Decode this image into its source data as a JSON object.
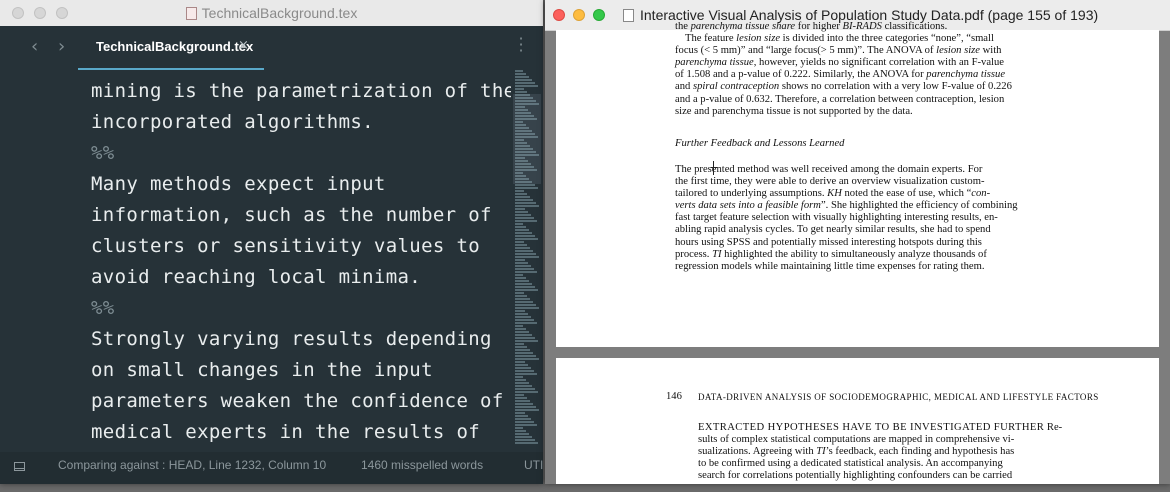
{
  "editor": {
    "window_title": "TechnicalBackground.tex",
    "tab_label": "TechnicalBackground.tex",
    "tab_close": "×",
    "nav_back": "‹",
    "nav_forward": "›",
    "code_lines": [
      {
        "text": "mining is the parametrization of the",
        "comment": false
      },
      {
        "text": "incorporated algorithms.",
        "comment": false
      },
      {
        "text": "%%",
        "comment": true
      },
      {
        "text": "Many methods expect input",
        "comment": false
      },
      {
        "text": "information, such as the number of",
        "comment": false
      },
      {
        "text": "clusters or sensitivity values to",
        "comment": false
      },
      {
        "text": "avoid reaching local minima.",
        "comment": false
      },
      {
        "text": "%%",
        "comment": true
      },
      {
        "text": "Strongly varying results depending",
        "comment": false
      },
      {
        "text": "on small changes in the input",
        "comment": false
      },
      {
        "text": "parameters weaken the confidence of",
        "comment": false
      },
      {
        "text": "medical experts in the results of",
        "comment": false
      }
    ],
    "status": {
      "comparing": "Comparing against : HEAD, Line 1232, Column 10",
      "misspelled": "1460 misspelled words",
      "encoding": "UTI"
    }
  },
  "pdf": {
    "window_title": "Interactive Visual Analysis of Population Study Data.pdf (page 155 of 193)",
    "page1": {
      "para1": [
        [
          {
            "t": "the "
          },
          {
            "t": "parenchyma tissue share",
            "i": true
          },
          {
            "t": " for higher "
          },
          {
            "t": "BI-RADS",
            "i": true
          },
          {
            "t": " classifications."
          }
        ],
        [
          {
            "t": "The feature "
          },
          {
            "t": "lesion size",
            "i": true
          },
          {
            "t": " is divided into the three categories “none”, “small"
          }
        ],
        [
          {
            "t": "focus (< 5 mm)” and “large focus(> 5 mm)”. The ANOVA of "
          },
          {
            "t": "lesion size",
            "i": true
          },
          {
            "t": " with"
          }
        ],
        [
          {
            "t": "parenchyma tissue",
            "i": true
          },
          {
            "t": ", however, yields no significant correlation with an F-value"
          }
        ],
        [
          {
            "t": "of 1.508 and a p-value of 0.222. Similarly, the ANOVA for "
          },
          {
            "t": "parenchyma tissue",
            "i": true
          }
        ],
        [
          {
            "t": "and "
          },
          {
            "t": "spiral contraception",
            "i": true
          },
          {
            "t": " shows no correlation with a very low F-value of 0.226"
          }
        ],
        [
          {
            "t": "and a p-value of 0.632. Therefore, a correlation between contraception, lesion"
          }
        ],
        [
          {
            "t": "size and parenchyma tissue is not supported by the data."
          }
        ]
      ],
      "heading": "Further Feedback and Lessons Learned",
      "para2": [
        [
          {
            "t": "The presented method was well received among the domain experts. For"
          }
        ],
        [
          {
            "t": "the first time, they were able to derive an overview visualization custom-"
          }
        ],
        [
          {
            "t": "tailored to underlying assumptions. "
          },
          {
            "t": "KH",
            "i": true
          },
          {
            "t": " noted the ease of use, which “"
          },
          {
            "t": "con-",
            "i": true
          }
        ],
        [
          {
            "t": "verts data sets into a feasible form",
            "i": true
          },
          {
            "t": "”. She highlighted the efficiency of combining"
          }
        ],
        [
          {
            "t": "fast target feature selection with visually highlighting interesting results, en-"
          }
        ],
        [
          {
            "t": "abling rapid analysis cycles. To get nearly similar results, she had to spend"
          }
        ],
        [
          {
            "t": "hours using SPSS and potentially missed interesting hotspots during this"
          }
        ],
        [
          {
            "t": "process. "
          },
          {
            "t": "TI",
            "i": true
          },
          {
            "t": " highlighted the ability to simultaneously analyze thousands of"
          }
        ],
        [
          {
            "t": "regression models while maintaining little time expenses for rating them."
          }
        ]
      ]
    },
    "page2": {
      "page_number": "146",
      "running_header": "DATA-DRIVEN ANALYSIS OF SOCIODEMOGRAPHIC, MEDICAL AND LIFESTYLE FACTORS",
      "lines": [
        [
          {
            "t": "EXTRACTED HYPOTHESES HAVE TO BE INVESTIGATED FURTHER",
            "sc": true
          },
          {
            "t": "   Re-"
          }
        ],
        [
          {
            "t": "sults of complex statistical computations are mapped in comprehensive vi-"
          }
        ],
        [
          {
            "t": "sualizations. Agreeing with "
          },
          {
            "t": "TI",
            "i": true
          },
          {
            "t": "’s feedback, each finding and hypothesis has"
          }
        ],
        [
          {
            "t": "to be confirmed using a dedicated statistical analysis. An accompanying"
          }
        ],
        [
          {
            "t": "search for correlations potentially highlighting confounders can be carried"
          }
        ]
      ]
    }
  },
  "colors": {
    "editor_bg": "#263238",
    "tab_accent": "#5aa9c9",
    "close_red": "#fc605c",
    "minimize_yellow": "#fdbc40",
    "zoom_green": "#34c84a"
  }
}
